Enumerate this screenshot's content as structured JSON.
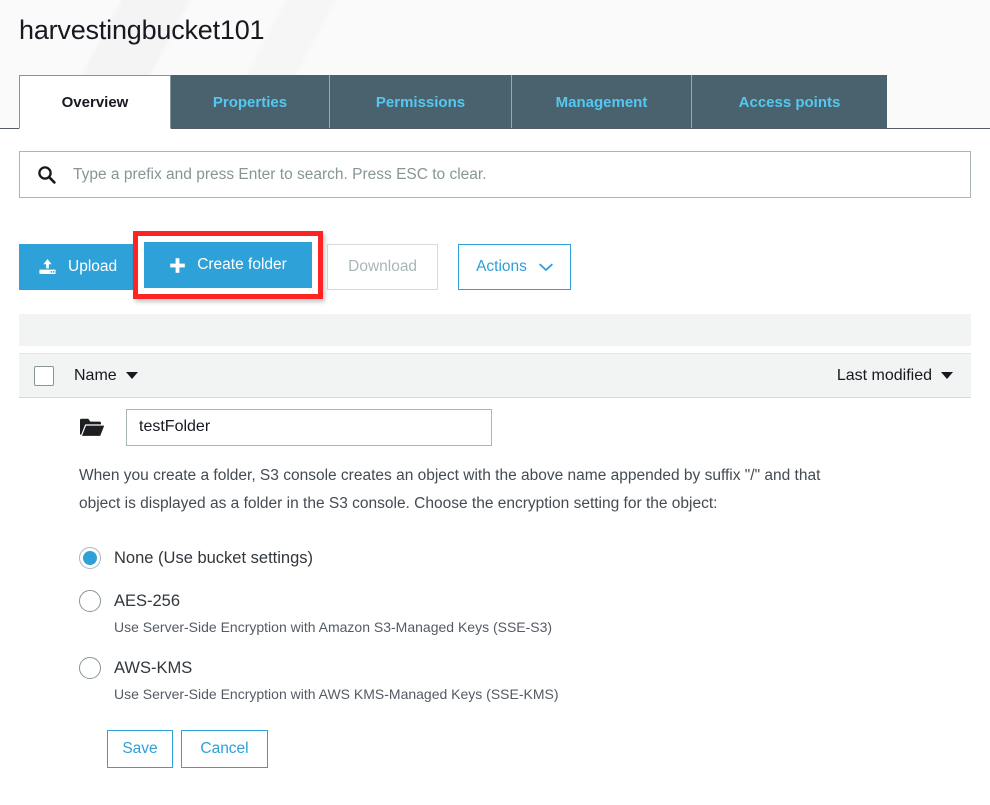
{
  "header": {
    "bucket_name": "harvestingbucket101"
  },
  "tabs": [
    {
      "label": "Overview",
      "active": true
    },
    {
      "label": "Properties",
      "active": false
    },
    {
      "label": "Permissions",
      "active": false
    },
    {
      "label": "Management",
      "active": false
    },
    {
      "label": "Access points",
      "active": false
    }
  ],
  "search": {
    "placeholder": "Type a prefix and press Enter to search. Press ESC to clear.",
    "value": "",
    "icon": "search-icon"
  },
  "toolbar": {
    "upload_label": "Upload",
    "upload_icon": "upload-icon",
    "create_folder_label": "Create folder",
    "create_folder_icon": "plus-icon",
    "download_label": "Download",
    "download_disabled": true,
    "actions_label": "Actions",
    "actions_icon": "chevron-down-icon"
  },
  "table": {
    "columns": {
      "name": "Name",
      "last_modified": "Last modified"
    },
    "sort_icon": "caret-down-icon"
  },
  "folder_form": {
    "folder_icon": "folder-icon",
    "name_value": "testFolder",
    "description": "When you create a folder, S3 console creates an object with the above name appended by suffix \"/\" and that object is displayed as a folder in the S3 console. Choose the encryption setting for the object:",
    "encryption_options": [
      {
        "label": "None (Use bucket settings)",
        "sublabel": "",
        "selected": true
      },
      {
        "label": "AES-256",
        "sublabel": "Use Server-Side Encryption with Amazon S3-Managed Keys (SSE-S3)",
        "selected": false
      },
      {
        "label": "AWS-KMS",
        "sublabel": "Use Server-Side Encryption with AWS KMS-Managed Keys (SSE-KMS)",
        "selected": false
      }
    ],
    "save_label": "Save",
    "cancel_label": "Cancel"
  },
  "annotation": {
    "target": "create-folder-button",
    "color": "#ff2424"
  },
  "colors": {
    "tab_active_bg": "#ffffff",
    "tab_inactive_bg": "#4a626e",
    "tab_inactive_text": "#54c8f0",
    "primary_button": "#2ea1d8",
    "link_blue": "#2f9fd8",
    "band_gray": "#f2f3f3",
    "disabled_text": "#aab7b8",
    "annotation_red": "#ff2424"
  }
}
